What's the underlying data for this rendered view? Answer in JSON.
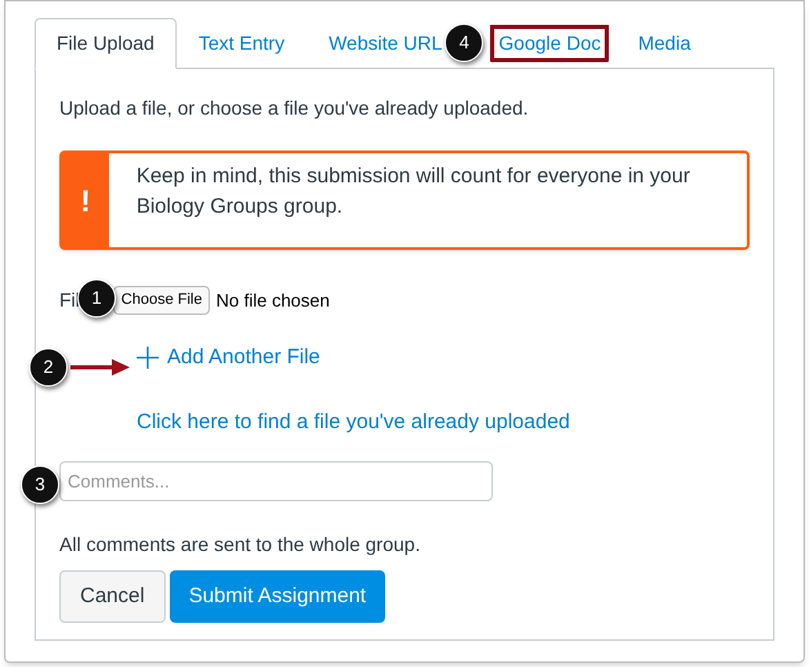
{
  "tabs": [
    {
      "label": "File Upload",
      "selected": true,
      "highlighted": false
    },
    {
      "label": "Text Entry",
      "selected": false,
      "highlighted": false
    },
    {
      "label": "Website URL",
      "selected": false,
      "highlighted": false
    },
    {
      "label": "Google Doc",
      "selected": false,
      "highlighted": true
    },
    {
      "label": "Media",
      "selected": false,
      "highlighted": false
    }
  ],
  "instructions": "Upload a file, or choose a file you've already uploaded.",
  "alert": {
    "icon": "!",
    "message": "Keep in mind, this submission will count for everyone in your Biology Groups group."
  },
  "file_field": {
    "label": "Fil",
    "button": "Choose File",
    "status": "No file chosen"
  },
  "add_file_link": "Add Another File",
  "find_file_link": "Click here to find a file you've already uploaded",
  "comments": {
    "placeholder": "Comments..."
  },
  "comments_note": "All comments are sent to the whole group.",
  "buttons": [
    {
      "label": "Cancel",
      "kind": "secondary"
    },
    {
      "label": "Submit Assignment",
      "kind": "primary"
    }
  ],
  "callouts": [
    "1",
    "2",
    "3",
    "4"
  ]
}
